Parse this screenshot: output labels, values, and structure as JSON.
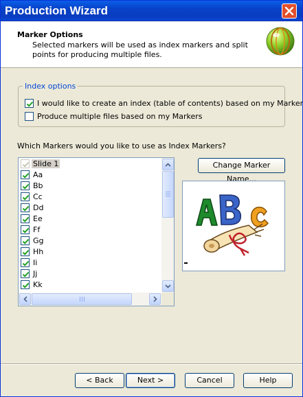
{
  "window": {
    "title": "Production Wizard"
  },
  "header": {
    "title": "Marker Options",
    "description": "Selected markers will be used as index markers and split points for producing multiple files."
  },
  "index_options": {
    "legend": "Index options",
    "create_index": {
      "label": "I would like to create an index (table of contents) based on my Markers.",
      "checked": true
    },
    "multiple_files": {
      "label": "Produce multiple files based on my Markers",
      "checked": false
    }
  },
  "markers": {
    "question": "Which Markers would you like to use as Index Markers?",
    "items": [
      {
        "label": "Slide 1",
        "checked": true,
        "disabled": true,
        "selected": true
      },
      {
        "label": "Aa",
        "checked": true
      },
      {
        "label": "Bb",
        "checked": true
      },
      {
        "label": "Cc",
        "checked": true
      },
      {
        "label": "Dd",
        "checked": true
      },
      {
        "label": "Ee",
        "checked": true
      },
      {
        "label": "Ff",
        "checked": true
      },
      {
        "label": "Gg",
        "checked": true
      },
      {
        "label": "Hh",
        "checked": true
      },
      {
        "label": "Ii",
        "checked": true
      },
      {
        "label": "Jj",
        "checked": true
      },
      {
        "label": "Kk",
        "checked": true
      }
    ],
    "change_name_button": "Change Marker Name..."
  },
  "preview": {
    "image": "abc-scroll-clipart"
  },
  "buttons": {
    "back": "< Back",
    "next": "Next >",
    "cancel": "Cancel",
    "help": "Help"
  },
  "colors": {
    "title_bar": "#0842c8",
    "close_button": "#e24f2b",
    "check_mark": "#21a121",
    "legend_text": "#0046d5"
  }
}
